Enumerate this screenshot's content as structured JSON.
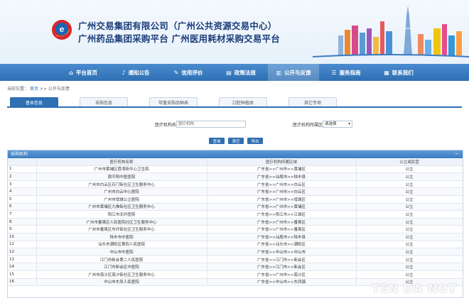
{
  "header": {
    "title_line1": "广州交易集团有限公司（广州公共资源交易中心）",
    "title_line2": "广州药品集团采购平台 广州医用耗材采购交易平台"
  },
  "nav": {
    "items": [
      {
        "label": "平台首页",
        "icon": "home-icon"
      },
      {
        "label": "通知公告",
        "icon": "bell-icon"
      },
      {
        "label": "信用评价",
        "icon": "edit-icon"
      },
      {
        "label": "政策法规",
        "icon": "document-icon"
      },
      {
        "label": "公开与反馈",
        "icon": "chart-icon",
        "active": true
      },
      {
        "label": "服务指南",
        "icon": "list-icon"
      },
      {
        "label": "联系我们",
        "icon": "grid-icon"
      }
    ]
  },
  "breadcrumb": {
    "prefix": "当前位置：",
    "home": "首页",
    "sep": ">>",
    "current": "公开与反馈"
  },
  "tabs": [
    {
      "label": "基本信息",
      "active": true
    },
    {
      "label": "采购信息"
    },
    {
      "label": "带量采购品种表"
    },
    {
      "label": "口腔种植体"
    },
    {
      "label": "其它专项"
    }
  ],
  "form": {
    "org_name_label": "医疗机构名称：",
    "org_name_value": "医疗机构",
    "org_region_label": "医疗机构所属区域：",
    "org_region_value": "请选择"
  },
  "buttons": {
    "search": "查询",
    "reset": "清空",
    "export": "导出"
  },
  "table": {
    "panel_title": "采购机构",
    "columns": [
      "",
      "医疗机构名称",
      "医疗机构所属区域",
      "公立或民营"
    ],
    "rows": [
      [
        "1",
        "广州市黄埔区荔湾街中心卫生院",
        "广东省>>广州市>>黄埔区",
        "公立"
      ],
      [
        "2",
        "周平阳中医医院",
        "广东省>>汕尾市>>陆丰县",
        "公立"
      ],
      [
        "3",
        "广州市白云区石门街社区卫生服务中心",
        "广东省>>广州市>>白云区",
        "公立"
      ],
      [
        "4",
        "广州市白云中心医院",
        "广东省>>广州市>>白云区",
        "公立"
      ],
      [
        "5",
        "广州市增城公立医院",
        "广东省>>广州市>>增城区",
        "公立"
      ],
      [
        "6",
        "广州市黄埔区九佛街社区卫生服务中心",
        "广东省>>广州市>>黄埔区",
        "公立"
      ],
      [
        "7",
        "阳江市北环医院",
        "广东省>>阳江市>>江城区",
        "公立"
      ],
      [
        "8",
        "广州市番禺区人民医院社区卫生服务中心",
        "广东省>>广州市>>番禺区",
        "公立"
      ],
      [
        "9",
        "广州市番禺区东环街社区卫生服务中心",
        "广东省>>广州市>>番禺区",
        "公立"
      ],
      [
        "10",
        "陆丰市中医院",
        "广东省>>汕尾市>>陆丰县",
        "公立"
      ],
      [
        "11",
        "汕头市潮阳区第四人民医院",
        "广东省>>汕头市>>潮阳区",
        "公立"
      ],
      [
        "12",
        "中山市中医院",
        "广东省>>中山市>>中山市",
        "公立"
      ],
      [
        "13",
        "江门市新会第二人民医院",
        "广东省>>江门市>>新会区",
        "公立"
      ],
      [
        "14",
        "江门市新会区中医院",
        "广东省>>江门市>>新会区",
        "公立"
      ],
      [
        "15",
        "广州市南沙区南沙街社区卫生服务中心",
        "广东省>>广州市>>南沙区",
        "公立"
      ],
      [
        "16",
        "中山市东凤人民医院",
        "广东省>>中山市>>东凤镇",
        "公立"
      ]
    ]
  },
  "watermark": "TEN DA NOT"
}
